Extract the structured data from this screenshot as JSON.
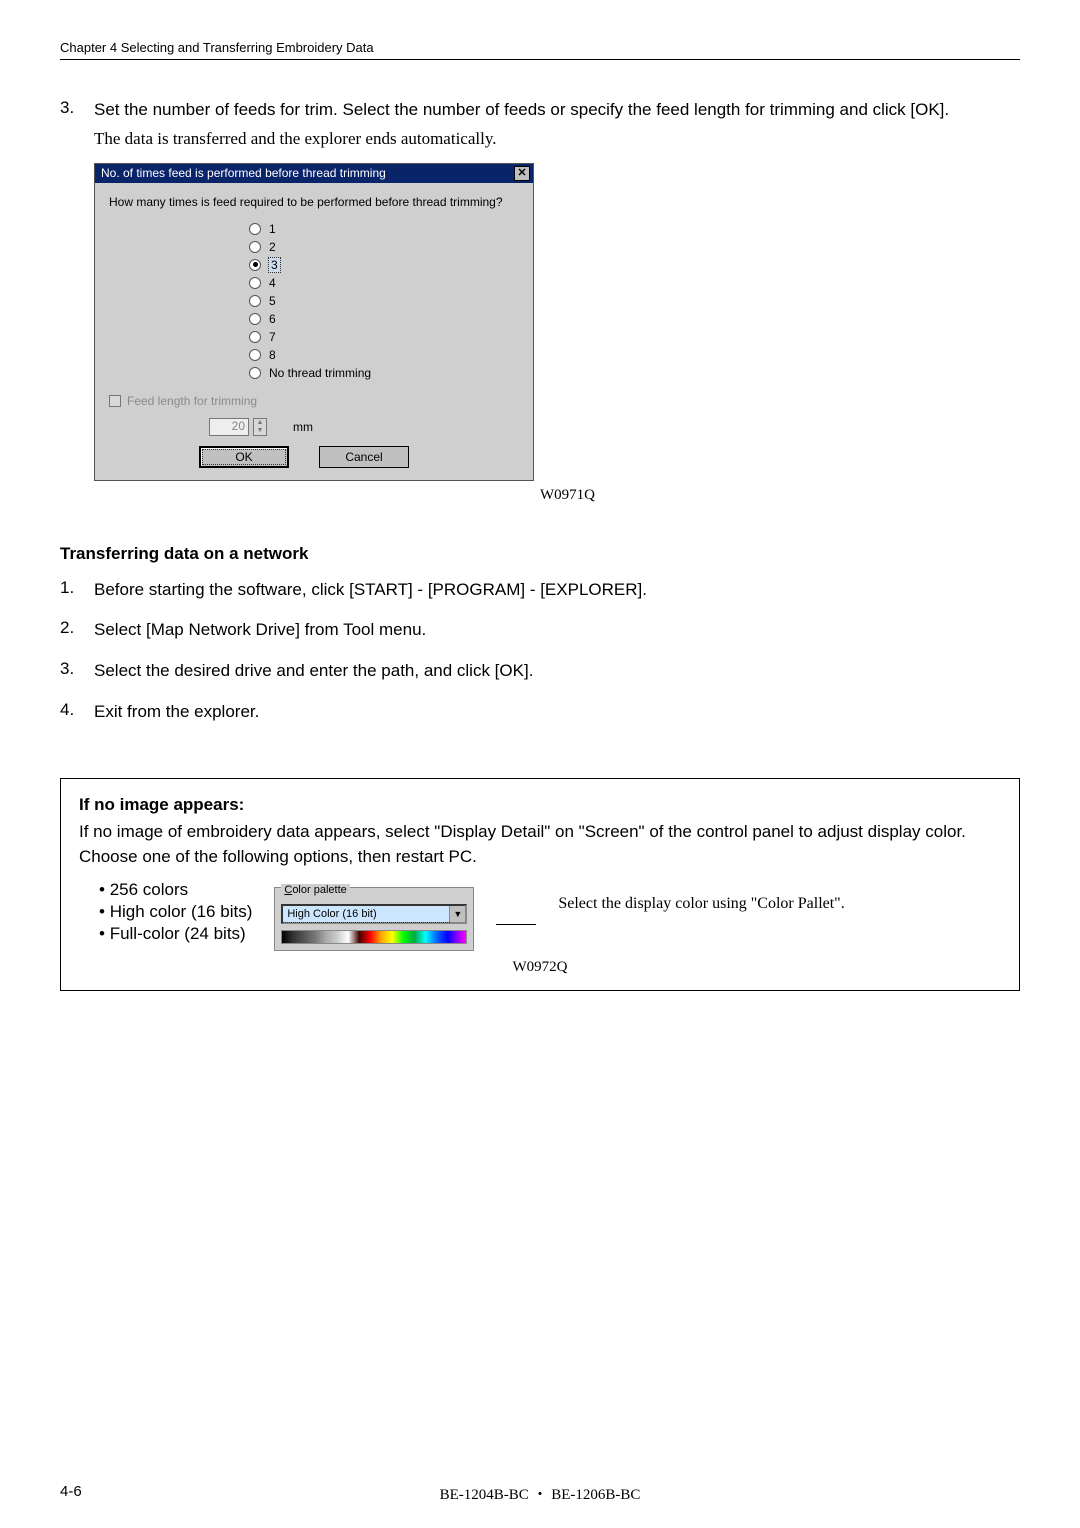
{
  "header": {
    "chapter": "Chapter 4    Selecting and Transferring Embroidery Data"
  },
  "step3": {
    "num": "3.",
    "text": "Set the number of feeds for trim.   Select the number of feeds or specify the feed length for trimming and click [OK].",
    "note": "The data is transferred and the explorer ends automatically."
  },
  "dialog": {
    "title": "No. of times feed is performed before thread trimming",
    "close": "✕",
    "prompt": "How many times is feed required to be performed before thread trimming?",
    "options": {
      "o1": "1",
      "o2": "2",
      "o3": "3",
      "o4": "4",
      "o5": "5",
      "o6": "6",
      "o7": "7",
      "o8": "8",
      "o9": "No thread trimming"
    },
    "feed_label": "Feed length for trimming",
    "feed_val": "20",
    "mm": "mm",
    "ok": "OK",
    "cancel": "Cancel"
  },
  "figref1": "W0971Q",
  "section2": {
    "heading": "Transferring data on a network",
    "s1n": "1.",
    "s1": "Before starting the software, click [START] - [PROGRAM] - [EXPLORER].",
    "s2n": "2.",
    "s2": "Select [Map Network Drive] from Tool menu.",
    "s3n": "3.",
    "s3": "Select the desired drive and enter the path, and click [OK].",
    "s4n": "4.",
    "s4": "Exit from the explorer."
  },
  "box": {
    "head": "If no image appears:",
    "p1": "If no image of embroidery data appears, select \"Display Detail\" on \"Screen\" of the control panel to adjust display color.",
    "p2": "Choose one of the following options, then restart PC.",
    "b1": "256 colors",
    "b2": "High color (16 bits)",
    "b3": "Full-color (24 bits)",
    "palette_legend_pre": "C",
    "palette_legend_post": "olor palette",
    "palette_value": "High Color (16 bit)",
    "note": "Select the display color using \"Color Pallet\".",
    "figref": "W0972Q"
  },
  "footer": {
    "left": "4-6",
    "center": "BE-1204B-BC ・ BE-1206B-BC"
  }
}
